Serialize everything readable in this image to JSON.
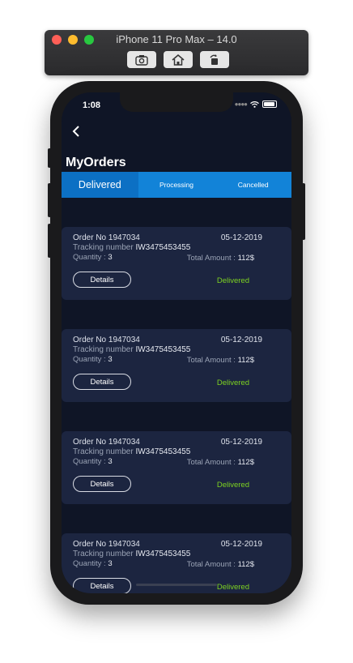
{
  "simulator": {
    "title": "iPhone 11 Pro Max – 14.0",
    "buttons": [
      "screenshot-icon",
      "home-icon",
      "rotate-icon"
    ]
  },
  "status_bar": {
    "time": "1:08"
  },
  "header": {
    "title": "MyOrders"
  },
  "tabs": [
    {
      "label": "Delivered",
      "active": true
    },
    {
      "label": "Processing",
      "active": false
    },
    {
      "label": "Cancelled",
      "active": false
    }
  ],
  "orders": [
    {
      "order_label": "Order No 1947034",
      "date": "05-12-2019",
      "tracking_label": "Tracking number",
      "tracking_number": "IW3475453455",
      "quantity_label": "Quantity :",
      "quantity": "3",
      "total_label": "Total Amount :",
      "total": "112$",
      "details_label": "Details",
      "status": "Delivered"
    },
    {
      "order_label": "Order No 1947034",
      "date": "05-12-2019",
      "tracking_label": "Tracking number",
      "tracking_number": "IW3475453455",
      "quantity_label": "Quantity :",
      "quantity": "3",
      "total_label": "Total Amount :",
      "total": "112$",
      "details_label": "Details",
      "status": "Delivered"
    },
    {
      "order_label": "Order No 1947034",
      "date": "05-12-2019",
      "tracking_label": "Tracking number",
      "tracking_number": "IW3475453455",
      "quantity_label": "Quantity :",
      "quantity": "3",
      "total_label": "Total Amount :",
      "total": "112$",
      "details_label": "Details",
      "status": "Delivered"
    },
    {
      "order_label": "Order No 1947034",
      "date": "05-12-2019",
      "tracking_label": "Tracking number",
      "tracking_number": "IW3475453455",
      "quantity_label": "Quantity :",
      "quantity": "3",
      "total_label": "Total Amount :",
      "total": "112$",
      "details_label": "Details",
      "status": "Delivered"
    }
  ],
  "colors": {
    "background": "#0f1526",
    "card": "#1c2540",
    "tab_bar": "#1283d8",
    "status_delivered": "#7ed321"
  }
}
